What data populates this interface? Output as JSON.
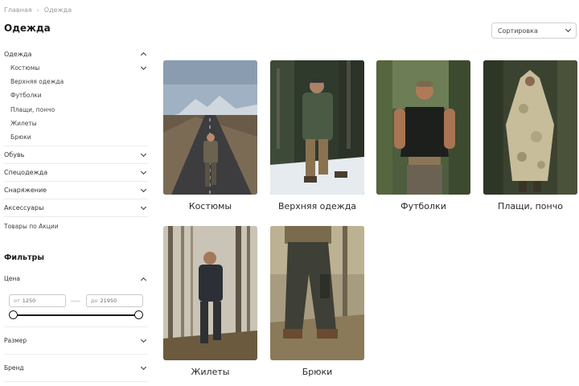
{
  "breadcrumb": {
    "home": "Главная",
    "sep": "›",
    "current": "Одежда"
  },
  "page_title": "Одежда",
  "sort": {
    "label": "Сортировка"
  },
  "sidebar": {
    "open_category": "Одежда",
    "sub_items": [
      "Костюмы",
      "Верхняя одежда",
      "Футболки",
      "Плащи, пончо",
      "Жилеты",
      "Брюки"
    ],
    "categories": [
      "Обувь",
      "Спецодежда",
      "Снаряжение",
      "Аксессуары"
    ],
    "promo": "Товары по Акции"
  },
  "filters": {
    "title": "Фильтры",
    "price": {
      "label": "Цена",
      "from_prefix": "от",
      "from_value": "1250",
      "to_prefix": "до",
      "to_value": "21950"
    },
    "size_label": "Размер",
    "brand_label": "Бренд"
  },
  "products": [
    {
      "name": "Костюмы",
      "scene": "road"
    },
    {
      "name": "Верхняя одежда",
      "scene": "snow"
    },
    {
      "name": "Футболки",
      "scene": "tshirt"
    },
    {
      "name": "Плащи, пончо",
      "scene": "poncho"
    },
    {
      "name": "Жилеты",
      "scene": "forest"
    },
    {
      "name": "Брюки",
      "scene": "pants"
    }
  ],
  "colors": {
    "accent": "#1c1c1c",
    "border": "#d0d0d0",
    "divider": "#ececec"
  }
}
